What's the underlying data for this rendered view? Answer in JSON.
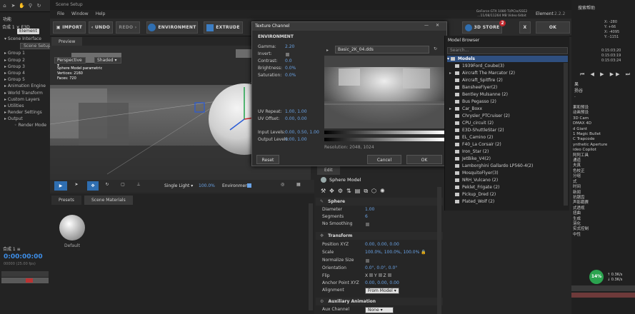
{
  "ae": {
    "toolbar_icons": [
      "home-icon",
      "selection-icon",
      "hand-icon",
      "zoom-icon",
      "orbit-icon"
    ],
    "menu_fragment": "功能",
    "project_label": "合成 1 × E3D",
    "layer_badge": "Element",
    "tree": [
      "Scene Interface",
      "Scene Setup",
      "Group 1",
      "Group 2",
      "Group 3",
      "Group 4",
      "Group 5",
      "Animation Engine",
      "World Transform",
      "Custom Layers",
      "Utilities",
      "Render Settings",
      "Output",
      "Render Mode"
    ],
    "timeline_tab": "合成 1 ≡",
    "timecode": "0:00:00:00",
    "timecode_sub": "00000 (25.00 fps)"
  },
  "window": {
    "title": "Scene Setup",
    "menu": [
      "File",
      "Window",
      "Help"
    ]
  },
  "toolbar": {
    "import": "IMPORT",
    "undo": "UNDO",
    "redo": "REDO",
    "environment": "ENVIRONMENT",
    "extrude": "EXTRUDE",
    "store": "3D STORE",
    "store_badge": "2",
    "close": "X",
    "ok": "OK",
    "gpu_line1": "GeForce GTX 1080 Ti/PCIe/SSE2",
    "gpu_line2": "...11/08/11264 MB Video 64bit",
    "element_label": "Element",
    "element_version": "2.2.2"
  },
  "preview": {
    "tab": "Preview",
    "camera": "Perspective",
    "shading": "Shaded",
    "info_title": "Sphere Model parametric",
    "vertices_label": "Vertices:",
    "vertices": "2160",
    "faces_label": "Faces:",
    "faces": "720",
    "light_mode": "Single Light",
    "light_pct": "100.0%",
    "env_label": "Environment"
  },
  "presets": {
    "tabs": [
      "Presets",
      "Scene Materials"
    ],
    "default_label": "Default"
  },
  "dialog": {
    "title": "Texture Channel",
    "section": "ENVIRONMENT",
    "gamma_label": "Gamma:",
    "gamma": "2.20",
    "invert_label": "Invert:",
    "contrast_label": "Contrast:",
    "contrast": "0.0",
    "brightness_label": "Brightness:",
    "brightness": "0.0%",
    "saturation_label": "Saturation:",
    "saturation": "0.0%",
    "uvrepeat_label": "UV Repeat:",
    "uvrepeat": [
      "1.00,",
      "1.00"
    ],
    "uvoffset_label": "UV Offset:",
    "uvoffset": [
      "0.00,",
      "0.00"
    ],
    "input_label": "Input Levels:",
    "input_levels": [
      "0.00,",
      "0.50,",
      "1.00"
    ],
    "output_label": "Output Levels:",
    "output_levels": [
      "0.00,",
      "1.00"
    ],
    "file": "Basic_2K_04.dds",
    "resolution": "Resolution: 2048, 1024",
    "reset": "Reset",
    "cancel": "Cancel",
    "ok": "OK"
  },
  "edit": {
    "tab": "Edit",
    "model": "Sphere Model",
    "sphere_section": "Sphere",
    "diameter_label": "Diameter",
    "diameter": "1.00",
    "segments_label": "Segments",
    "segments": "6",
    "nosmooth_label": "No Smoothing",
    "transform_section": "Transform",
    "pos_label": "Position XYZ",
    "pos": [
      "0.00,",
      "0.00,",
      "0.00"
    ],
    "scale_label": "Scale",
    "scale": [
      "100.0%,",
      "100.0%,",
      "100.0%"
    ],
    "normalize_label": "Normalize Size",
    "orient_label": "Orientation",
    "orient": [
      "0.0°,",
      "0.0°,",
      "0.0°"
    ],
    "flip_label": "Flip",
    "flip": [
      "X",
      "Y",
      "Z"
    ],
    "anchor_label": "Anchor Point XYZ",
    "anchor": [
      "0.00,",
      "0.00,",
      "0.00"
    ],
    "align_label": "Alignment",
    "align_value": "From Model",
    "aux_section": "Auxiliary Animation",
    "aux_label": "Aux Channel",
    "aux_value": "None"
  },
  "model_browser": {
    "title": "Model Browser",
    "search_placeholder": "Search...",
    "root": "Models",
    "items": [
      "1939Ford_Coube(3)",
      "Aircraft The Marcator (2)",
      "Aircraft_Spitfire (2)",
      "BansheeFlyer(2)",
      "Bentley Mulsanne (2)",
      "Bus Pegasso (2)",
      "Car_Boxx",
      "Chrysler_PTCruiser (2)",
      "CPU_circuit (2)",
      "E3D-ShuttleStar (2)",
      "EL_Camino (2)",
      "F40_La Corsair (2)",
      "Iron_Star (2)",
      "JetBike_V4(2)",
      "Lamborghini Gallardo LP560-4(2)",
      "MosquitoFlyer(3)",
      "NRH_Vulcano (2)",
      "Peklet_Frigate (2)",
      "Pickup_Dred (2)",
      "Plated_Wolf (2)"
    ],
    "expandable": [
      1,
      6
    ]
  },
  "right_panel": {
    "top": [
      "搜索帮助"
    ],
    "coords": [
      "X: -280",
      "Y: +66",
      "X: -4095",
      "Y: -1151"
    ],
    "times": [
      "0:15:03:20",
      "0:15:03:19",
      "0:15:03:24"
    ],
    "labels": [
      "果",
      "扬谷",
      "·"
    ],
    "effects": [
      "果和预设",
      "动画预设",
      "3D Cam",
      "DMAX 4D",
      "d Giant",
      "1 Magic Bullet",
      "C Trapcode",
      "ynthetic Aperture",
      "ideo Copilot",
      "阿阿工具",
      "通道",
      "夫真",
      "色校正",
      "分组",
      "式",
      "时间",
      "新闻",
      "抗锯齿",
      "声影戳赛",
      "式透视",
      "扭曲",
      "生成",
      "溶化",
      "实式控制",
      "中性"
    ],
    "pct": "14%",
    "rate_up": "0.3K/s",
    "rate_down": "0.3K/s"
  }
}
